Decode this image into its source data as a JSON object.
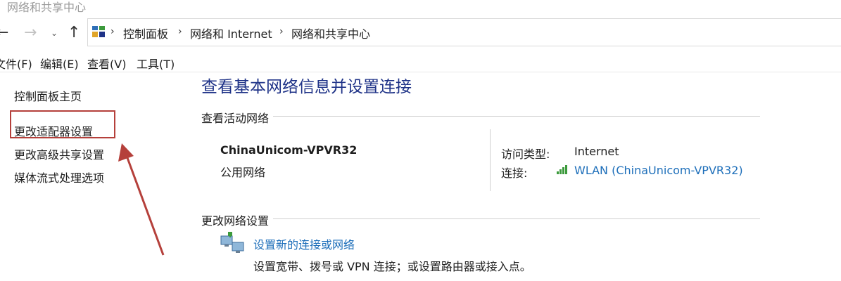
{
  "window": {
    "title": "网络和共享中心"
  },
  "nav": {
    "breadcrumbs": [
      "控制面板",
      "网络和 Internet",
      "网络和共享中心"
    ]
  },
  "menu": {
    "items": [
      "文件(F)",
      "编辑(E)",
      "查看(V)",
      "工具(T)"
    ]
  },
  "sidebar": {
    "items": [
      "控制面板主页",
      "更改适配器设置",
      "更改高级共享设置",
      "媒体流式处理选项"
    ]
  },
  "main": {
    "title": "查看基本网络信息并设置连接",
    "active_section_title": "查看活动网络",
    "network": {
      "name": "ChinaUnicom-VPVR32",
      "type": "公用网络",
      "access_label": "访问类型:",
      "access_value": "Internet",
      "connection_label": "连接:",
      "connection_value": "WLAN (ChinaUnicom-VPVR32)"
    },
    "change_section_title": "更改网络设置",
    "tasks": [
      {
        "link": "设置新的连接或网络",
        "description": "设置宽带、拨号或 VPN 连接；或设置路由器或接入点。"
      }
    ]
  },
  "colors": {
    "accent_title": "#1e3287",
    "link": "#1e6fba",
    "annotation": "#b5403b",
    "signal": "#3c9a3c"
  },
  "icons": [
    "back-arrow-icon",
    "forward-arrow-icon",
    "recent-locations-icon",
    "up-arrow-icon",
    "control-panel-icon",
    "wifi-signal-icon",
    "network-setup-icon"
  ]
}
